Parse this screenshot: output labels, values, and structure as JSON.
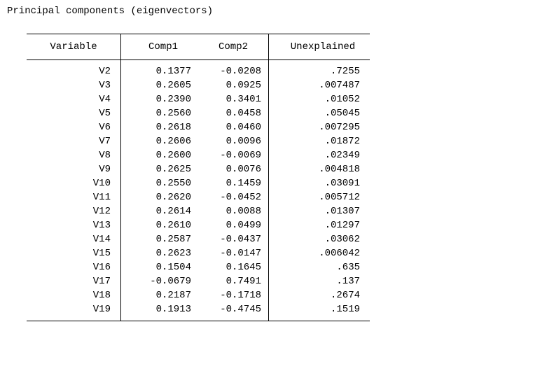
{
  "title": "Principal components (eigenvectors)",
  "headers": {
    "variable": "Variable",
    "comp1": "Comp1",
    "comp2": "Comp2",
    "unexplained": "Unexplained"
  },
  "rows": [
    {
      "variable": "V2",
      "comp1": "0.1377",
      "comp2": "-0.0208",
      "unexplained": ".7255"
    },
    {
      "variable": "V3",
      "comp1": "0.2605",
      "comp2": "0.0925",
      "unexplained": ".007487"
    },
    {
      "variable": "V4",
      "comp1": "0.2390",
      "comp2": "0.3401",
      "unexplained": ".01052"
    },
    {
      "variable": "V5",
      "comp1": "0.2560",
      "comp2": "0.0458",
      "unexplained": ".05045"
    },
    {
      "variable": "V6",
      "comp1": "0.2618",
      "comp2": "0.0460",
      "unexplained": ".007295"
    },
    {
      "variable": "V7",
      "comp1": "0.2606",
      "comp2": "0.0096",
      "unexplained": ".01872"
    },
    {
      "variable": "V8",
      "comp1": "0.2600",
      "comp2": "-0.0069",
      "unexplained": ".02349"
    },
    {
      "variable": "V9",
      "comp1": "0.2625",
      "comp2": "0.0076",
      "unexplained": ".004818"
    },
    {
      "variable": "V10",
      "comp1": "0.2550",
      "comp2": "0.1459",
      "unexplained": ".03091"
    },
    {
      "variable": "V11",
      "comp1": "0.2620",
      "comp2": "-0.0452",
      "unexplained": ".005712"
    },
    {
      "variable": "V12",
      "comp1": "0.2614",
      "comp2": "0.0088",
      "unexplained": ".01307"
    },
    {
      "variable": "V13",
      "comp1": "0.2610",
      "comp2": "0.0499",
      "unexplained": ".01297"
    },
    {
      "variable": "V14",
      "comp1": "0.2587",
      "comp2": "-0.0437",
      "unexplained": ".03062"
    },
    {
      "variable": "V15",
      "comp1": "0.2623",
      "comp2": "-0.0147",
      "unexplained": ".006042"
    },
    {
      "variable": "V16",
      "comp1": "0.1504",
      "comp2": "0.1645",
      "unexplained": ".635"
    },
    {
      "variable": "V17",
      "comp1": "-0.0679",
      "comp2": "0.7491",
      "unexplained": ".137"
    },
    {
      "variable": "V18",
      "comp1": "0.2187",
      "comp2": "-0.1718",
      "unexplained": ".2674"
    },
    {
      "variable": "V19",
      "comp1": "0.1913",
      "comp2": "-0.4745",
      "unexplained": ".1519"
    }
  ]
}
